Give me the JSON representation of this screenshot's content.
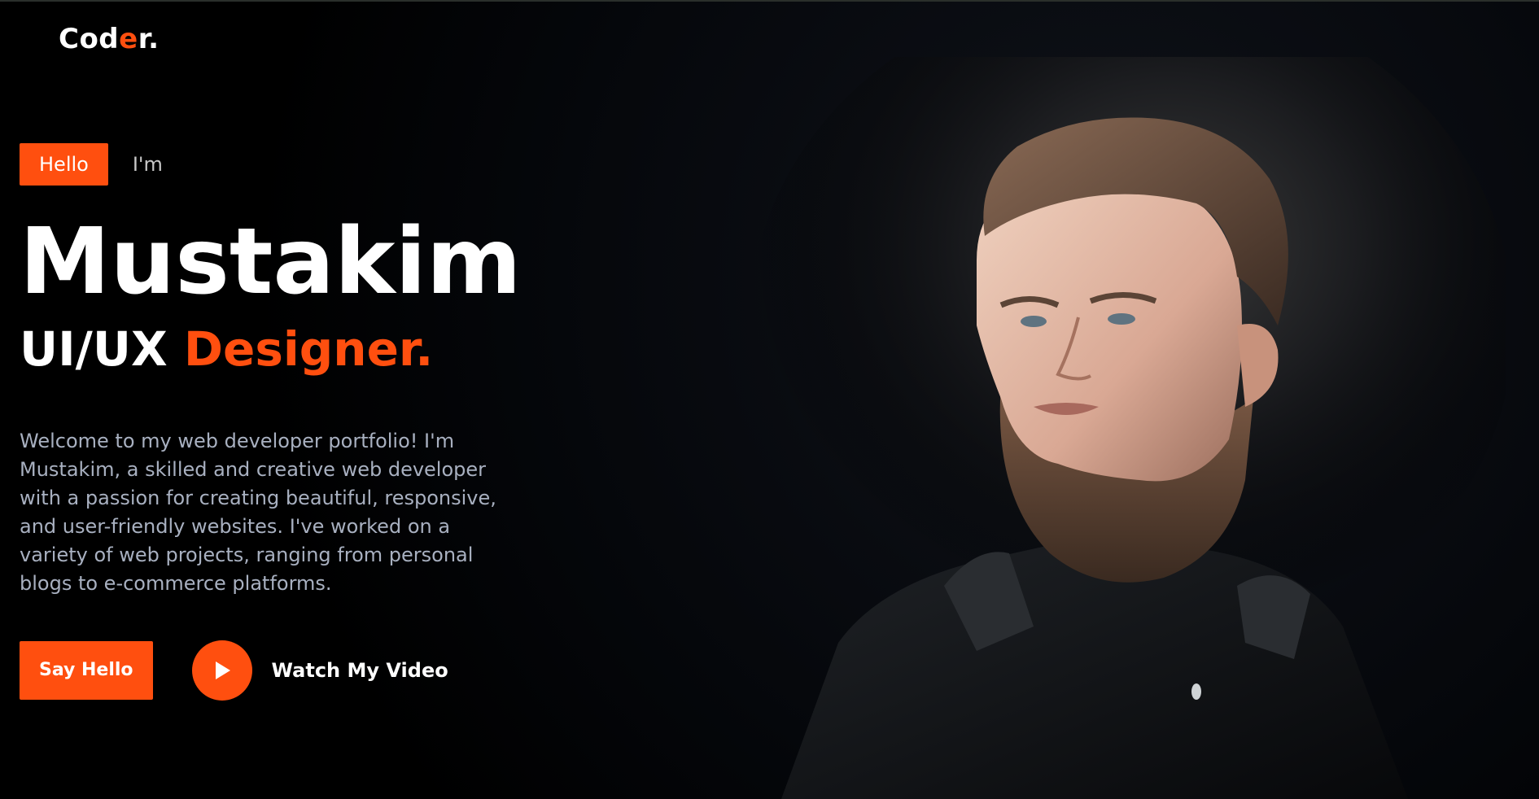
{
  "brand": {
    "logo_part1": "Cod",
    "logo_part2": "e",
    "logo_part3": "r.",
    "accent_color": "#ff4f0f"
  },
  "hero": {
    "hello_badge": "Hello",
    "im_text": "I'm",
    "name": "Mustakim",
    "role_part1": "UI/UX",
    "role_part2": "Designer.",
    "description": "Welcome to my web developer portfolio! I'm Mustakim, a skilled and creative web developer with a passion for creating beautiful, responsive, and user-friendly websites. I've worked on a variety of web projects, ranging from personal blogs to e-commerce platforms."
  },
  "actions": {
    "say_hello_label": "Say Hello",
    "watch_video_label": "Watch My Video",
    "play_icon": "play-icon"
  },
  "image": {
    "portrait_icon": "portrait-photo"
  }
}
